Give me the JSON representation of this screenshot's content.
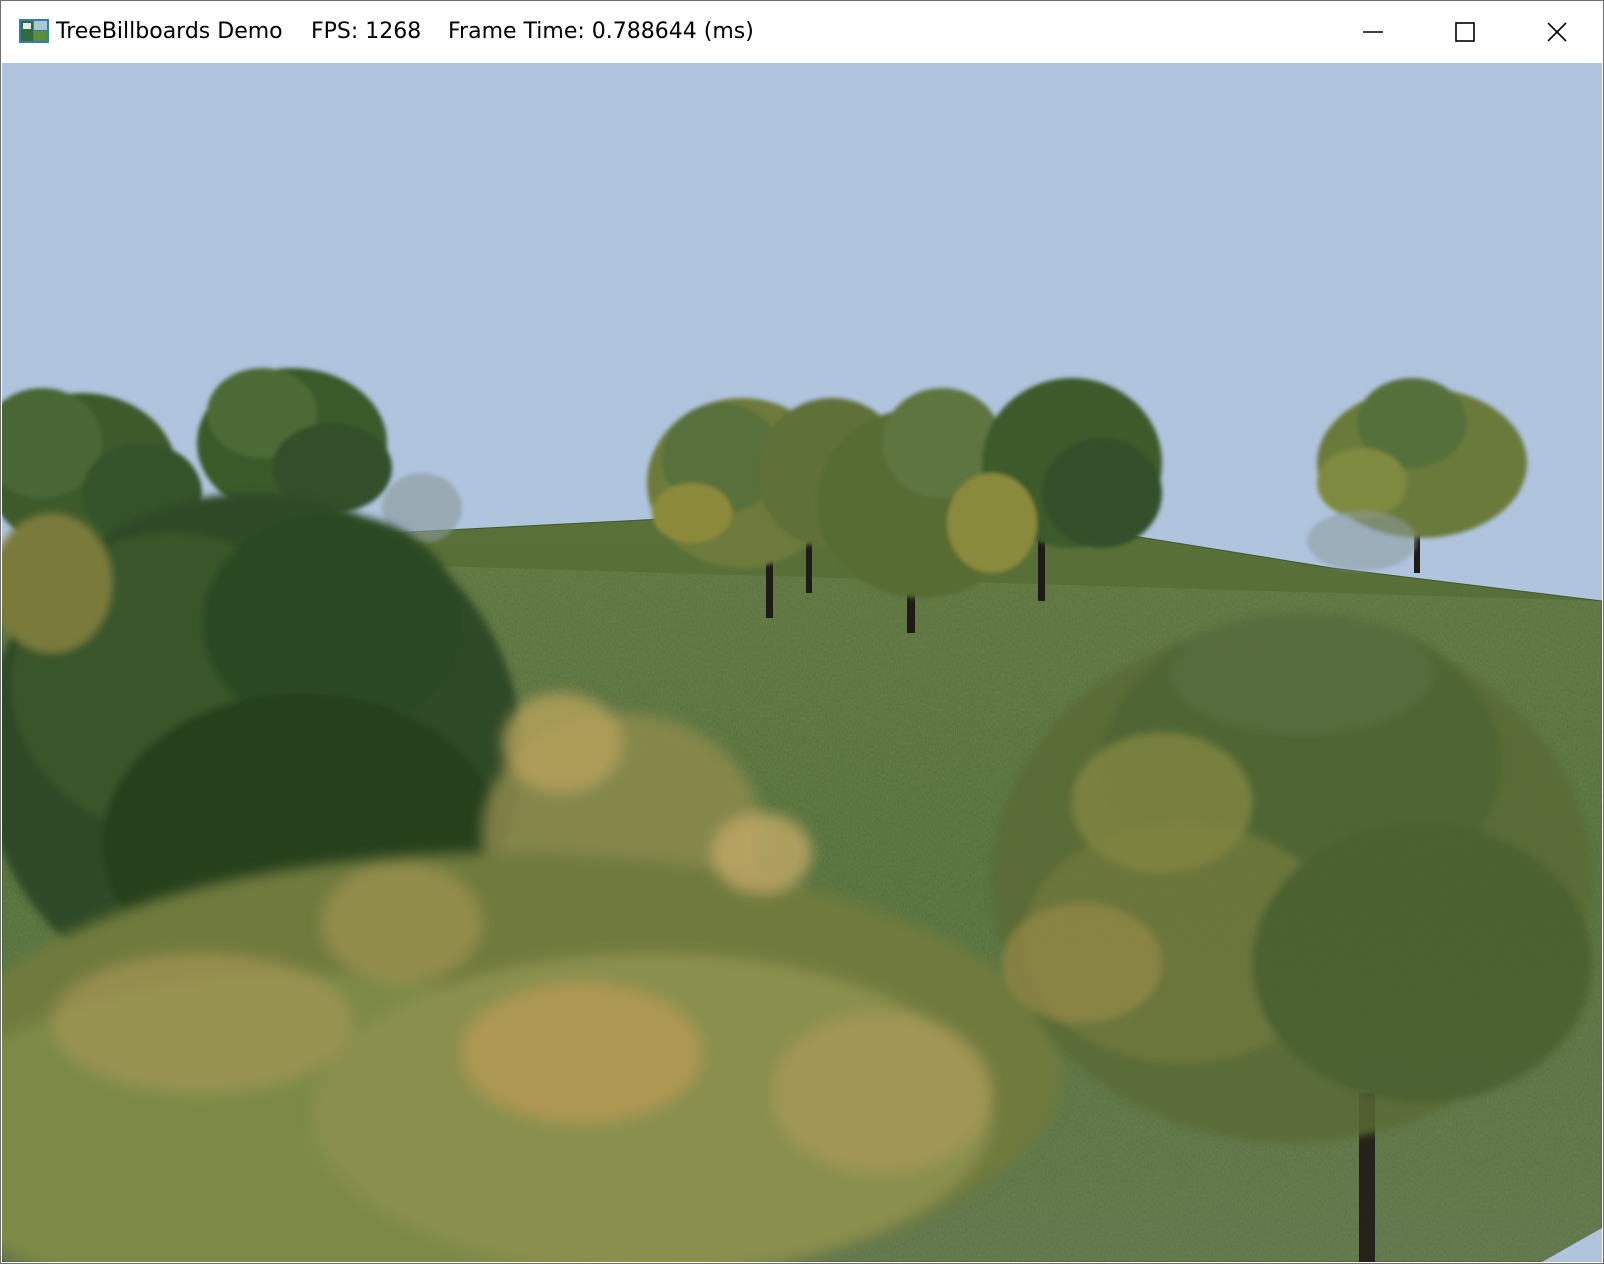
{
  "window": {
    "app_title": "TreeBillboards Demo",
    "fps": "FPS: 1268",
    "frame_time": "Frame Time: 0.788644 (ms)",
    "buttons": {
      "minimize": "minimize-icon",
      "maximize": "maximize-icon",
      "close": "close-icon"
    }
  },
  "scene": {
    "description_colors": {
      "sky": "#b0c4de",
      "grass": "#4f6a34",
      "foliage_dark": "#2e4a24",
      "foliage_light": "#7f8a3c",
      "trunk": "#1e1a16"
    }
  }
}
